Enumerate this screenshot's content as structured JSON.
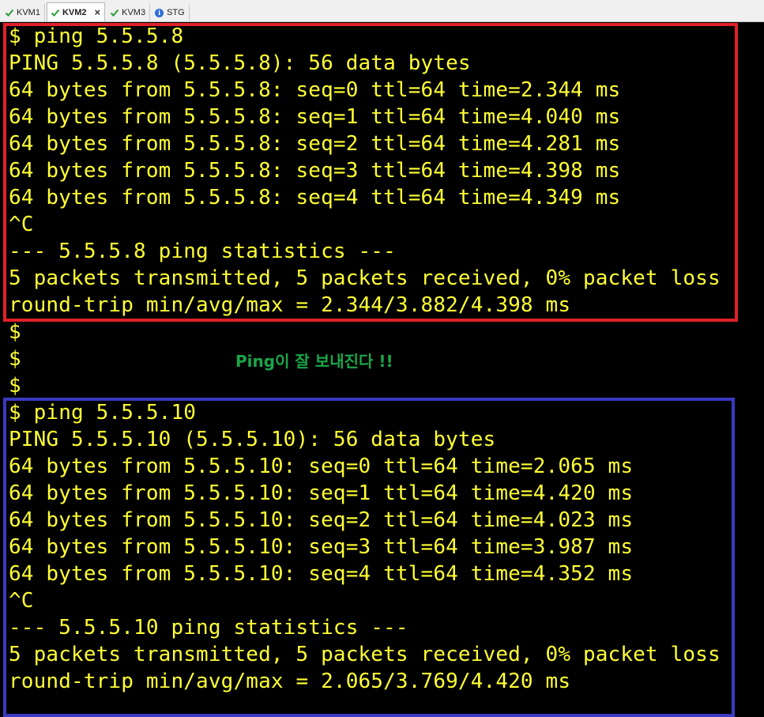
{
  "tabs": [
    {
      "label": "KVM1",
      "icon": "check-icon",
      "active": false
    },
    {
      "label": "KVM2",
      "icon": "check-icon",
      "active": true,
      "close": "×"
    },
    {
      "label": "KVM3",
      "icon": "check-icon",
      "active": false
    },
    {
      "label": "STG",
      "icon": "info-icon",
      "active": false
    }
  ],
  "terminal": {
    "text_color": "#ffff33",
    "lines": [
      "$ ping 5.5.5.8",
      "PING 5.5.5.8 (5.5.5.8): 56 data bytes",
      "64 bytes from 5.5.5.8: seq=0 ttl=64 time=2.344 ms",
      "64 bytes from 5.5.5.8: seq=1 ttl=64 time=4.040 ms",
      "64 bytes from 5.5.5.8: seq=2 ttl=64 time=4.281 ms",
      "64 bytes from 5.5.5.8: seq=3 ttl=64 time=4.398 ms",
      "64 bytes from 5.5.5.8: seq=4 ttl=64 time=4.349 ms",
      "^C",
      "--- 5.5.5.8 ping statistics ---",
      "5 packets transmitted, 5 packets received, 0% packet loss",
      "round-trip min/avg/max = 2.344/3.882/4.398 ms",
      "$",
      "$",
      "$",
      "$ ping 5.5.5.10",
      "PING 5.5.5.10 (5.5.5.10): 56 data bytes",
      "64 bytes from 5.5.5.10: seq=0 ttl=64 time=2.065 ms",
      "64 bytes from 5.5.5.10: seq=1 ttl=64 time=4.420 ms",
      "64 bytes from 5.5.5.10: seq=2 ttl=64 time=4.023 ms",
      "64 bytes from 5.5.5.10: seq=3 ttl=64 time=3.987 ms",
      "64 bytes from 5.5.5.10: seq=4 ttl=64 time=4.352 ms",
      "^C",
      "--- 5.5.5.10 ping statistics ---",
      "5 packets transmitted, 5 packets received, 0% packet loss",
      "round-trip min/avg/max = 2.065/3.769/4.420 ms"
    ]
  },
  "annotation": {
    "text": "Ping이 잘 보내진다 !!",
    "color": "#1aa64a"
  },
  "highlights": {
    "first_color": "#e0202a",
    "second_color": "#3a3ac0"
  }
}
